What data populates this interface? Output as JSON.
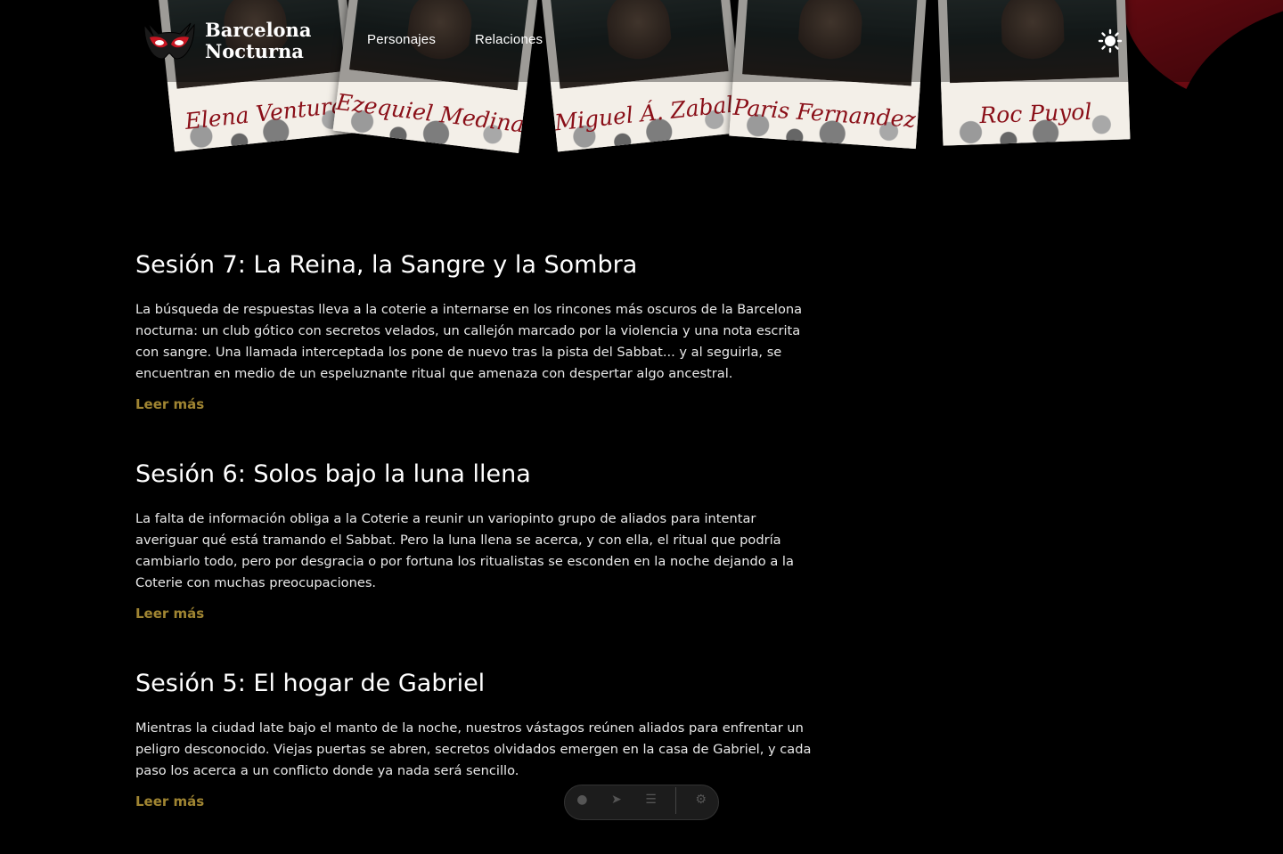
{
  "header": {
    "brand_line1": "Barcelona",
    "brand_line2": "Nocturna",
    "logo_icon": "masquerade-mask-icon",
    "nav": [
      {
        "label": "Personajes"
      },
      {
        "label": "Relaciones"
      }
    ],
    "theme_icon": "sun-icon"
  },
  "characters": [
    {
      "name": "Elena Ventura"
    },
    {
      "name": "Ezequiel Medina"
    },
    {
      "name": "Miguel Á. Zabaleta"
    },
    {
      "name": "Paris Fernandez"
    },
    {
      "name": "Roc Puyol"
    }
  ],
  "sessions": [
    {
      "title": "Sesión 7: La Reina, la Sangre y la Sombra",
      "summary": "La búsqueda de respuestas lleva a la coterie a internarse en los rincones más oscuros de la Barcelona nocturna: un club gótico con secretos velados, un callejón marcado por la violencia y una nota escrita con sangre. Una llamada interceptada los pone de nuevo tras la pista del Sabbat... y al seguirla, se encuentran en medio de un espeluznante ritual que amenaza con despertar algo ancestral.",
      "link": "Leer más"
    },
    {
      "title": "Sesión 6: Solos bajo la luna llena",
      "summary": "La falta de información obliga a la Coterie a reunir un variopinto grupo de aliados para intentar averiguar qué está tramando el Sabbat. Pero la luna llena se acerca, y con ella, el ritual que podría cambiarlo todo, pero por desgracia o por fortuna los ritualistas se esconden en la noche dejando a la Coterie con muchas preocupaciones.",
      "link": "Leer más"
    },
    {
      "title": "Sesión 5: El hogar de Gabriel",
      "summary": "Mientras la ciudad late bajo el manto de la noche, nuestros vástagos reúnen aliados para enfrentar un peligro desconocido. Viejas puertas se abren, secretos olvidados emergen en la casa de Gabriel, y cada paso los acerca a un conflicto donde ya nada será sencillo.",
      "link": "Leer más"
    }
  ],
  "colors": {
    "background": "#000000",
    "link": "#a08532",
    "accent": "#8a0f18"
  },
  "dock": {
    "icons": [
      "person-icon",
      "pointer-icon",
      "list-icon",
      "gear-icon"
    ]
  }
}
